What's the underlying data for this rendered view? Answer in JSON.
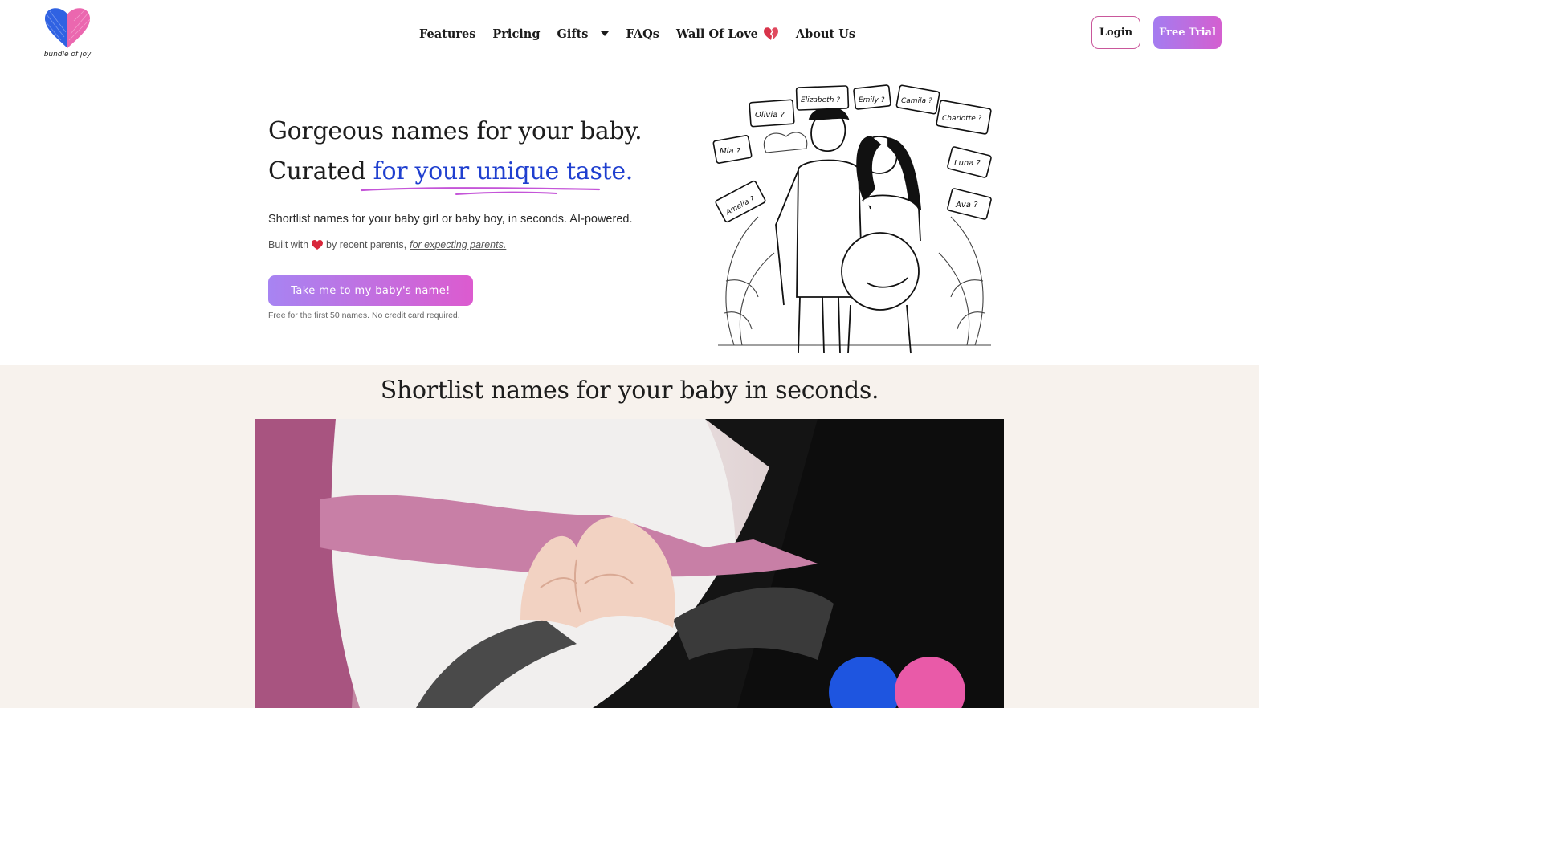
{
  "brand": {
    "logo_text": "bundle of joy",
    "colors": {
      "blue": "#1e55e0",
      "pink": "#e95aa8",
      "accent_text": "#1f3fcf"
    }
  },
  "nav": {
    "items": [
      {
        "label": "Features"
      },
      {
        "label": "Pricing"
      },
      {
        "label": "Gifts",
        "icon": "caret-down-icon"
      },
      {
        "label": "FAQs"
      },
      {
        "label": "Wall Of Love",
        "icon": "broken-heart-icon"
      },
      {
        "label": "About Us"
      }
    ]
  },
  "header_buttons": {
    "login": "Login",
    "trial": "Free Trial"
  },
  "hero": {
    "line1": "Gorgeous names for your baby.",
    "line2_prefix": "Curated ",
    "line2_accent": "for your unique taste.",
    "subtitle": "Shortlist names for your baby girl or baby boy, in seconds. AI-powered.",
    "built_prefix": "Built with",
    "built_middle": "by recent parents,",
    "built_link": "for expecting parents.",
    "cta": "Take me to my baby's name!",
    "note": "Free for the first 50 names. No credit card required."
  },
  "illustration": {
    "bubbles": [
      "Olivia ?",
      "Elizabeth ?",
      "Emily ?",
      "Camila ?",
      "Charlotte ?",
      "Mia ?",
      "Luna ?",
      "Amelia ?",
      "Ava ?"
    ]
  },
  "section2": {
    "title": "Shortlist names for your baby in seconds."
  }
}
